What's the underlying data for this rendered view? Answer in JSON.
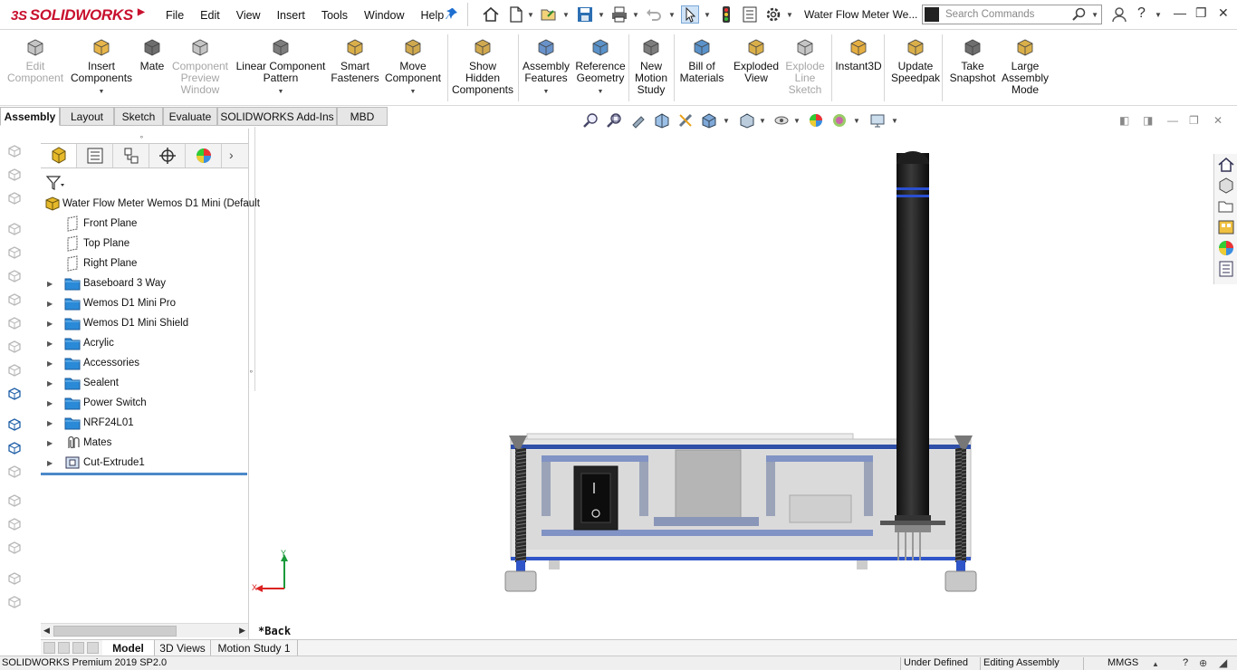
{
  "app": {
    "brand": "SOLIDWORKS",
    "brand_prefix": "3S",
    "document_title": "Water Flow Meter We..."
  },
  "menu": [
    "File",
    "Edit",
    "View",
    "Insert",
    "Tools",
    "Window",
    "Help"
  ],
  "search": {
    "placeholder": "Search Commands"
  },
  "ribbon": [
    {
      "label": "Edit\nComponent",
      "icon": "edit-component-icon",
      "disabled": true
    },
    {
      "label": "Insert\nComponents",
      "icon": "insert-components-icon",
      "disabled": false,
      "dropdown": true
    },
    {
      "label": "Mate",
      "icon": "paperclip-icon",
      "disabled": false
    },
    {
      "label": "Component\nPreview\nWindow",
      "icon": "preview-window-icon",
      "disabled": true
    },
    {
      "label": "Linear Component\nPattern",
      "icon": "linear-pattern-icon",
      "disabled": false,
      "dropdown": true
    },
    {
      "label": "Smart\nFasteners",
      "icon": "smart-fasteners-icon",
      "disabled": false
    },
    {
      "label": "Move\nComponent",
      "icon": "move-component-icon",
      "disabled": false,
      "dropdown": true
    },
    {
      "label": "Show\nHidden\nComponents",
      "icon": "show-hidden-icon",
      "disabled": false
    },
    {
      "label": "Assembly\nFeatures",
      "icon": "assembly-features-icon",
      "disabled": false,
      "dropdown": true
    },
    {
      "label": "Reference\nGeometry",
      "icon": "reference-geometry-icon",
      "disabled": false,
      "dropdown": true
    },
    {
      "label": "New\nMotion\nStudy",
      "icon": "motion-study-icon",
      "disabled": false
    },
    {
      "label": "Bill of\nMaterials",
      "icon": "bom-icon",
      "disabled": false
    },
    {
      "label": "Exploded\nView",
      "icon": "exploded-view-icon",
      "disabled": false
    },
    {
      "label": "Explode\nLine\nSketch",
      "icon": "explode-line-icon",
      "disabled": true
    },
    {
      "label": "Instant3D",
      "icon": "instant3d-icon",
      "disabled": false
    },
    {
      "label": "Update\nSpeedpak",
      "icon": "speedpak-icon",
      "disabled": false
    },
    {
      "label": "Take\nSnapshot",
      "icon": "camera-icon",
      "disabled": false
    },
    {
      "label": "Large\nAssembly\nMode",
      "icon": "large-assembly-icon",
      "disabled": false
    }
  ],
  "command_tabs": [
    "Assembly",
    "Layout",
    "Sketch",
    "Evaluate",
    "SOLIDWORKS Add-Ins",
    "MBD"
  ],
  "tree": {
    "root": "Water Flow Meter Wemos D1 Mini  (Default",
    "items": [
      {
        "label": "Front Plane",
        "icon": "plane-icon",
        "expandable": false
      },
      {
        "label": "Top Plane",
        "icon": "plane-icon",
        "expandable": false
      },
      {
        "label": "Right Plane",
        "icon": "plane-icon",
        "expandable": false
      },
      {
        "label": "Baseboard 3 Way",
        "icon": "folder-icon",
        "expandable": true
      },
      {
        "label": "Wemos D1 Mini Pro",
        "icon": "folder-icon",
        "expandable": true
      },
      {
        "label": "Wemos D1 Mini Shield",
        "icon": "folder-icon",
        "expandable": true
      },
      {
        "label": "Acrylic",
        "icon": "folder-icon",
        "expandable": true
      },
      {
        "label": "Accessories",
        "icon": "folder-icon",
        "expandable": true
      },
      {
        "label": "Sealent",
        "icon": "folder-icon",
        "expandable": true
      },
      {
        "label": "Power Switch",
        "icon": "folder-icon",
        "expandable": true
      },
      {
        "label": "NRF24L01",
        "icon": "folder-icon",
        "expandable": true
      },
      {
        "label": "Mates",
        "icon": "mates-icon",
        "expandable": true
      },
      {
        "label": "Cut-Extrude1",
        "icon": "cut-extrude-icon",
        "expandable": true
      }
    ]
  },
  "viewport": {
    "view_label": "*Back",
    "axis_x": "X",
    "axis_y": "Y"
  },
  "model_tabs": [
    "Model",
    "3D Views",
    "Motion Study 1"
  ],
  "status": {
    "product": "SOLIDWORKS Premium 2019 SP2.0",
    "definition": "Under Defined",
    "mode": "Editing Assembly",
    "units": "MMGS"
  }
}
